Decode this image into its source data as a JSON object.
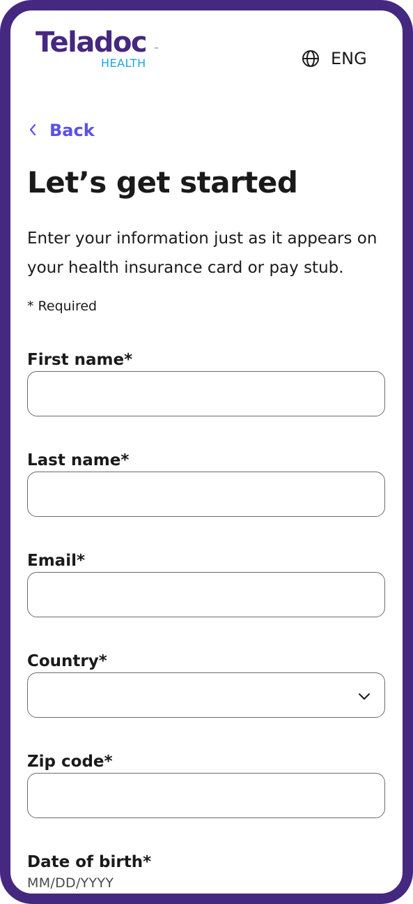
{
  "brand": {
    "name": "Teladoc",
    "trademark": "™",
    "subtitle": "HEALTH"
  },
  "language": {
    "icon": "globe-icon",
    "label": "ENG"
  },
  "nav": {
    "back_icon": "chevron-left-icon",
    "back_label": "Back"
  },
  "page": {
    "title": "Let’s get started",
    "intro": "Enter your information just as it appears on your health insurance card or pay stub.",
    "required_note": "* Required"
  },
  "form": {
    "first_name": {
      "label": "First name*",
      "value": "",
      "placeholder": ""
    },
    "last_name": {
      "label": "Last name*",
      "value": "",
      "placeholder": ""
    },
    "email": {
      "label": "Email*",
      "value": "",
      "placeholder": ""
    },
    "country": {
      "label": "Country*",
      "selected": "",
      "icon": "chevron-down-icon"
    },
    "zip_code": {
      "label": "Zip code*",
      "value": "",
      "placeholder": ""
    },
    "date_of_birth": {
      "label": "Date of birth*",
      "hint": "MM/DD/YYYY"
    }
  },
  "colors": {
    "frame": "#45287f",
    "brand_primary": "#45287f",
    "brand_secondary": "#19a6e0",
    "link": "#5a51e6",
    "input_border": "#6b6b6b"
  }
}
